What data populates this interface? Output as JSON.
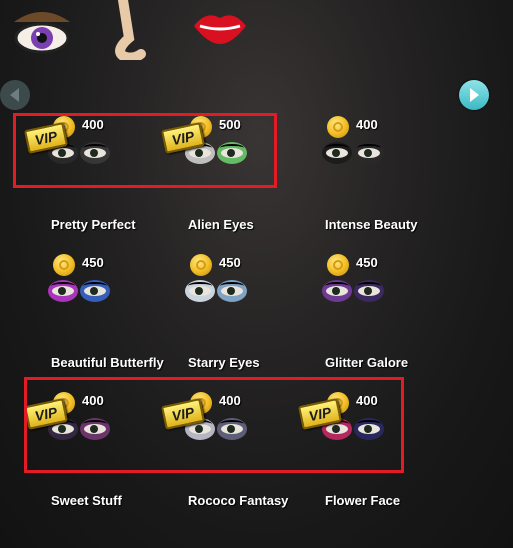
{
  "top_tabs": [
    {
      "icon": "eye-makeup-icon"
    },
    {
      "icon": "nose-icon"
    },
    {
      "icon": "lips-icon"
    }
  ],
  "navigation": {
    "prev_icon": "left-arrow-icon",
    "next_icon": "right-arrow-icon"
  },
  "vip_badge_text": "VIP",
  "items": [
    {
      "name": "Pretty Perfect",
      "price": "400",
      "vip": true,
      "colors": [
        "#2b2b2b",
        "#3b3b3b"
      ]
    },
    {
      "name": "Alien Eyes",
      "price": "500",
      "vip": true,
      "colors": [
        "#d8d8d8",
        "#6dd36d"
      ]
    },
    {
      "name": "Intense Beauty",
      "price": "400",
      "vip": false,
      "colors": [
        "#1a1a1a",
        "#2a2a2a"
      ]
    },
    {
      "name": "Beautiful Butterfly",
      "price": "450",
      "vip": false,
      "colors": [
        "#c23bd6",
        "#3a6bd6"
      ]
    },
    {
      "name": "Starry Eyes",
      "price": "450",
      "vip": false,
      "colors": [
        "#e8f3ff",
        "#8fb8e0"
      ]
    },
    {
      "name": "Glitter Galore",
      "price": "450",
      "vip": false,
      "colors": [
        "#7a3fa8",
        "#3f2a6a"
      ]
    },
    {
      "name": "Sweet Stuff",
      "price": "400",
      "vip": true,
      "colors": [
        "#3a2a4a",
        "#7a3a7a"
      ]
    },
    {
      "name": "Rococo Fantasy",
      "price": "400",
      "vip": true,
      "colors": [
        "#d0d0e0",
        "#6a6a8a"
      ]
    },
    {
      "name": "Flower Face",
      "price": "400",
      "vip": true,
      "colors": [
        "#d02a6a",
        "#2a2a6a"
      ]
    }
  ]
}
